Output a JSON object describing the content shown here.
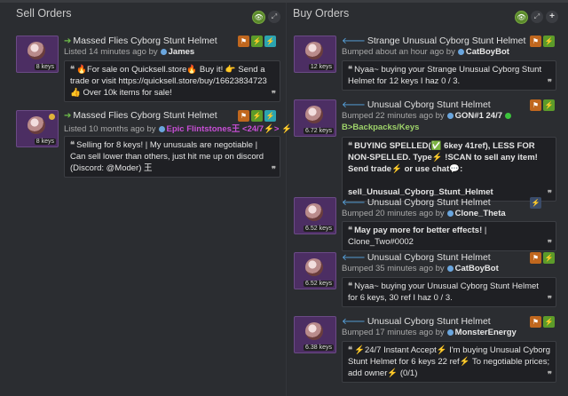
{
  "sell": {
    "header": "Sell Orders",
    "listings": [
      {
        "title": "Massed Flies Cyborg Stunt Helmet",
        "price": "8 keys",
        "listed": "Listed 14 minutes ago by",
        "user": "James",
        "message": "🔥For sale on Quicksell.store🔥 Buy it! 👉 Send a trade or visit https://quicksell.store/buy/16623834723 👍 Over 10k items for sale!"
      },
      {
        "title": "Massed Flies Cyborg Stunt Helmet",
        "price": "8 keys",
        "listed": "Listed 10 months ago by",
        "user": "Epic Flintstones王 <24/7⚡> ⚡",
        "message": "Selling for 8 keys! | My unusuals are negotiable | Can sell lower than others, just hit me up on discord (Discord: @Moder) 王"
      }
    ]
  },
  "buy": {
    "header": "Buy Orders",
    "listings": [
      {
        "title": "Strange Unusual Cyborg Stunt Helmet",
        "price": "12 keys",
        "listed": "Bumped about an hour ago by",
        "user": "CatBoyBot",
        "message": "Nyaa~ buying your Strange Unusual Cyborg Stunt Helmet for 12 keys I haz 0 / 3."
      },
      {
        "title": "Unusual Cyborg Stunt Helmet",
        "price": "6.72 keys",
        "listed": "Bumped 22 minutes ago by",
        "user": "GON#1 24/7",
        "tag": "B>Backpacks/Keys",
        "message_line1": "BUYING SPELLED(✅ 6key 41ref), LESS FOR NON-SPELLED. Type⚡ !SCAN to sell any item! Send  trade⚡ or  use  chat💬:",
        "message_line2": "sell_Unusual_Cyborg_Stunt_Helmet"
      },
      {
        "title": "Unusual Cyborg Stunt Helmet",
        "price": "6.52 keys",
        "listed": "Bumped 20 minutes ago by",
        "user": "Clone_Theta",
        "message_bold": "May pay more for better effects!",
        "message_rest": " | Clone_Two#0002"
      },
      {
        "title": "Unusual Cyborg Stunt Helmet",
        "price": "6.52 keys",
        "listed": "Bumped 35 minutes ago by",
        "user": "CatBoyBot",
        "message": "Nyaa~ buying your Unusual Cyborg Stunt Helmet for 6 keys, 30 ref I haz 0 / 3."
      },
      {
        "title": "Unusual Cyborg Stunt Helmet",
        "price": "6.38 keys",
        "listed": "Bumped 17 minutes ago by",
        "user": "MonsterEnergy",
        "message": "⚡24/7 Instant Accept⚡ I'm buying Unusual Cyborg Stunt Helmet for 6 keys 22 ref⚡ To negotiable prices; add owner⚡ (0/1)"
      }
    ]
  },
  "colors": {
    "sell_arrow": "#6fbf4a",
    "buy_arrow": "#5aa9e6",
    "accent_orange": "#c0671e",
    "accent_green": "#5c9b2a"
  }
}
